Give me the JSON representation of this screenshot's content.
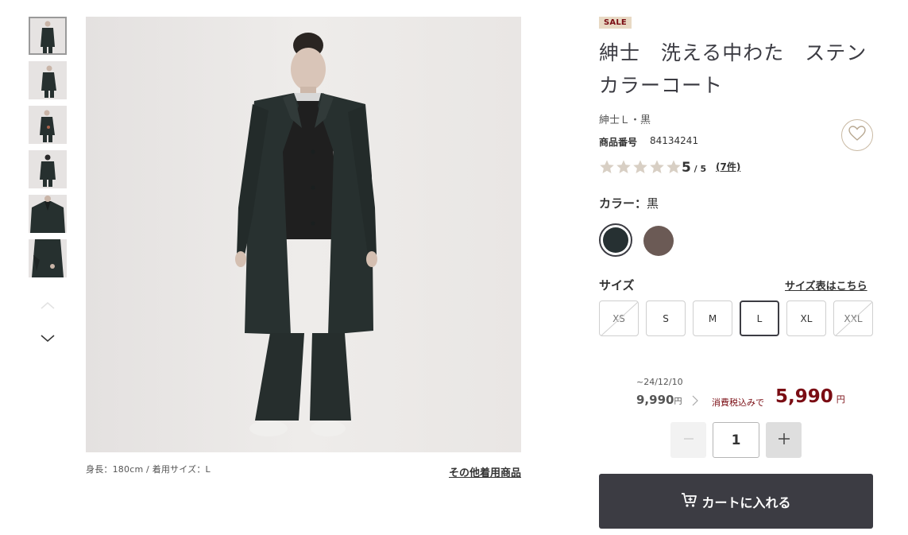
{
  "thumbnails": [
    {
      "name": "thumb-1"
    },
    {
      "name": "thumb-2"
    },
    {
      "name": "thumb-3"
    },
    {
      "name": "thumb-4"
    },
    {
      "name": "thumb-5"
    },
    {
      "name": "thumb-6"
    }
  ],
  "main_image": {
    "caption": "身長：180cm / 着用サイズ：L",
    "other_items_link": "その他着用商品"
  },
  "product": {
    "badge": "SALE",
    "title": "紳士　洗える中わた　ステンカラーコート",
    "subtitle": "紳士Ｌ・黒",
    "product_number_label": "商品番号",
    "product_number": "84134241",
    "rating": "5",
    "rating_max": " / 5",
    "reviews": "(7件)",
    "stars": 5
  },
  "color": {
    "label": "カラー：",
    "selected": "黒",
    "swatches": [
      {
        "name": "黒",
        "hex": "#263032",
        "selected": true
      },
      {
        "name": "brown",
        "hex": "#6b5a55",
        "selected": false
      }
    ]
  },
  "size": {
    "label": "サイズ",
    "chart_link": "サイズ表はこちら",
    "options": [
      {
        "label": "XS",
        "available": false,
        "selected": false
      },
      {
        "label": "S",
        "available": true,
        "selected": false
      },
      {
        "label": "M",
        "available": true,
        "selected": false
      },
      {
        "label": "L",
        "available": true,
        "selected": true
      },
      {
        "label": "XL",
        "available": true,
        "selected": false
      },
      {
        "label": "XXL",
        "available": false,
        "selected": false
      }
    ]
  },
  "price": {
    "date": "~24/12/10",
    "old_price": "9,990",
    "old_unit": "円",
    "tax_label": "消費税込みで",
    "new_price": "5,990",
    "new_unit": "円"
  },
  "quantity": {
    "minus": "−",
    "value": "1",
    "plus": "+"
  },
  "cart": {
    "label": "カートに入れる"
  },
  "colors": {
    "accent": "#7a0c13",
    "button": "#3c3c43",
    "badge_bg": "#e8d9c4",
    "star": "#d8cfc4"
  }
}
